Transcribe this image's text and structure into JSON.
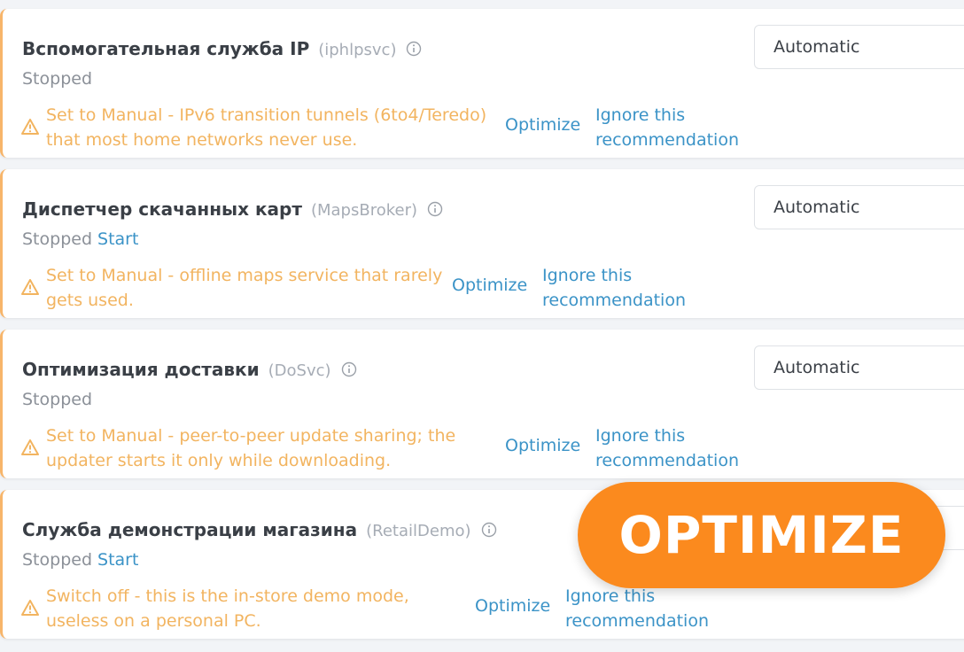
{
  "services": [
    {
      "name": "Вспомогательная служба IP",
      "id": "(iphlpsvc)",
      "status": "Stopped",
      "start_label": "",
      "recommendation_line1": "Set to Manual - IPv6 transition tunnels (6to4/Teredo)",
      "recommendation_line2": "that most home networks never use.",
      "optimize_label": "Optimize",
      "ignore_label": "Ignore this recommendation",
      "startup_type": "Automatic"
    },
    {
      "name": "Диспетчер скачанных карт",
      "id": "(MapsBroker)",
      "status": "Stopped",
      "start_label": "Start",
      "recommendation_line1": "Set to Manual - offline maps service that rarely",
      "recommendation_line2": "gets used.",
      "optimize_label": "Optimize",
      "ignore_label": "Ignore this recommendation",
      "startup_type": "Automatic"
    },
    {
      "name": "Оптимизация доставки",
      "id": "(DoSvc)",
      "status": "Stopped",
      "start_label": "",
      "recommendation_line1": "Set to Manual - peer-to-peer update sharing; the",
      "recommendation_line2": "updater starts it only while downloading.",
      "optimize_label": "Optimize",
      "ignore_label": "Ignore this recommendation",
      "startup_type": "Automatic"
    },
    {
      "name": "Служба демонстрации магазина",
      "id": "(RetailDemo)",
      "status": "Stopped",
      "start_label": "Start",
      "recommendation_line1": "Switch off - this is the in-store demo mode,",
      "recommendation_line2": "useless on a personal PC.",
      "optimize_label": "Optimize",
      "ignore_label": "Ignore this recommendation",
      "startup_type": ""
    }
  ],
  "cta": {
    "label": "OPTIMIZE"
  },
  "colors": {
    "accent_link": "#3b93c7",
    "warning": "#f2b460",
    "cta": "#fb8a1e"
  }
}
